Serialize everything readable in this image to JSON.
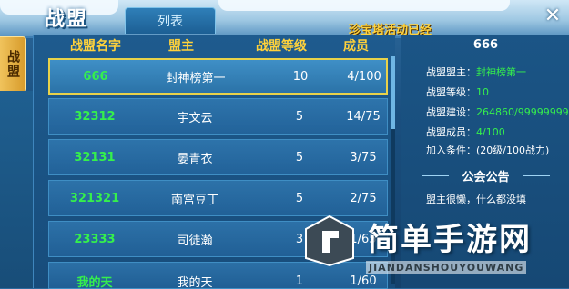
{
  "header": {
    "title": "战盟",
    "tab_list": "列表",
    "notice": "珍宝塔活动已经",
    "close": "✕"
  },
  "side_tab": {
    "label": "战盟"
  },
  "columns": {
    "name": "战盟名字",
    "leader": "盟主",
    "level": "战盟等级",
    "members": "成员"
  },
  "rows": [
    {
      "name": "666",
      "leader": "封神榜第一",
      "level": "10",
      "members": "4/100",
      "selected": true
    },
    {
      "name": "32312",
      "leader": "宇文云",
      "level": "5",
      "members": "14/75"
    },
    {
      "name": "32131",
      "leader": "晏青衣",
      "level": "5",
      "members": "3/75"
    },
    {
      "name": "321321",
      "leader": "南宫豆丁",
      "level": "5",
      "members": "2/75"
    },
    {
      "name": "23333",
      "leader": "司徒瀚",
      "level": "3",
      "members": "1/65"
    },
    {
      "name": "我的天",
      "leader": "我的天",
      "level": "1",
      "members": "1/60"
    }
  ],
  "detail": {
    "name": "666",
    "leader_label": "战盟盟主：",
    "leader_value": "封神榜第一",
    "level_label": "战盟等级：",
    "level_value": "10",
    "build_label": "战盟建设：",
    "build_value": "264860/99999999",
    "members_label": "战盟成员：",
    "members_value": "4/100",
    "join_condition": "加入条件：(20级/100战力)",
    "announce_title": "公会公告",
    "announce_text": "盟主很懒，什么都没填"
  },
  "watermark": {
    "cn": "简单手游网",
    "en": "JIANDANSHOUYOUWANG"
  },
  "colors": {
    "highlight_name": "#35f04c",
    "header_gold": "#ffd23b",
    "selected_border": "#e8d24a"
  }
}
